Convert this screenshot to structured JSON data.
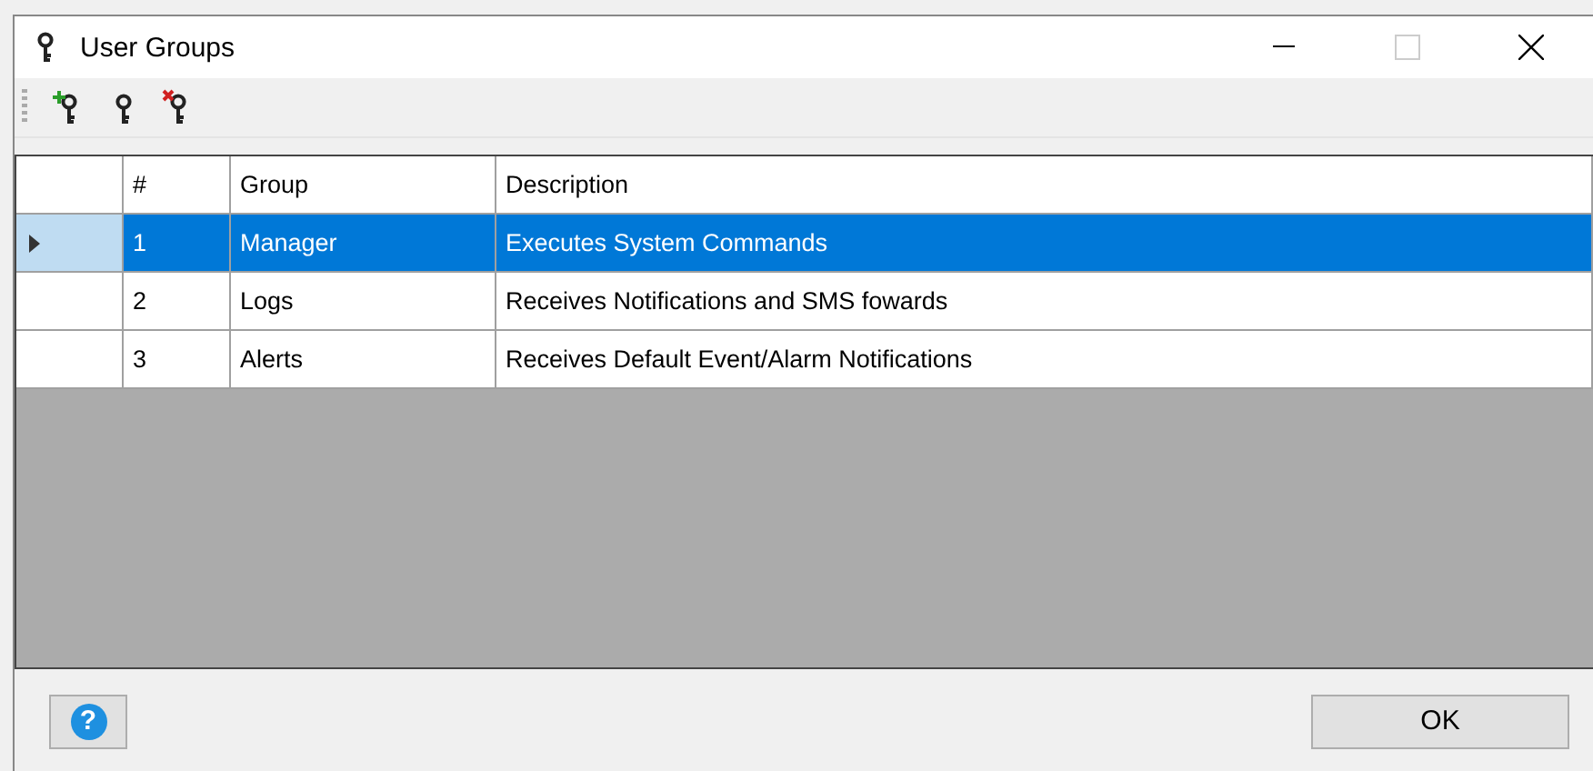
{
  "window": {
    "title": "User Groups"
  },
  "toolbar": [
    {
      "kind": "add",
      "disabled": false
    },
    {
      "kind": "edit",
      "disabled": false
    },
    {
      "kind": "delete",
      "disabled": false
    }
  ],
  "table": {
    "columns": [
      "#",
      "Group",
      "Description"
    ],
    "rows": [
      {
        "cells": [
          "1",
          "Manager",
          "Executes System Commands"
        ],
        "selected": true
      },
      {
        "cells": [
          "2",
          "Logs",
          "Receives Notifications and SMS fowards"
        ],
        "selected": false
      },
      {
        "cells": [
          "3",
          "Alerts",
          "Receives Default Event/Alarm Notifications"
        ],
        "selected": false
      }
    ]
  },
  "help_button": {
    "label": "?"
  },
  "buttons": [
    "OK"
  ]
}
